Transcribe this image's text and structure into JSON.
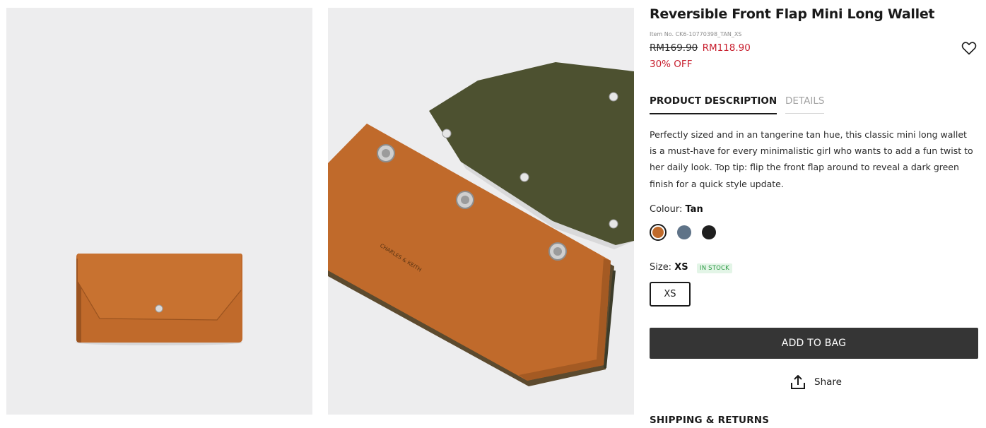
{
  "product": {
    "title": "Reversible Front Flap Mini Long Wallet",
    "item_no": "Item No. CK6-10770398_TAN_XS",
    "price_original": "RM169.90",
    "price_sale": "RM118.90",
    "discount": "30% OFF",
    "wishlist_icon": "heart-outline-icon"
  },
  "tabs": [
    {
      "label": "PRODUCT DESCRIPTION",
      "active": true
    },
    {
      "label": "DETAILS",
      "active": false
    }
  ],
  "description": "Perfectly sized and in an tangerine tan hue, this classic mini long wallet is a must-have for every minimalistic girl who wants to add a fun twist to her daily look. Top tip: flip the front flap around to reveal a dark green finish for a quick style update.",
  "colour": {
    "label": "Colour:",
    "selected": "Tan",
    "swatches": [
      {
        "name": "Tan",
        "hex": "#c06a2b",
        "selected": true
      },
      {
        "name": "Blue",
        "hex": "#5f7388",
        "selected": false
      },
      {
        "name": "Black",
        "hex": "#1f1f1f",
        "selected": false
      }
    ]
  },
  "size": {
    "label": "Size:",
    "selected": "XS",
    "stock": "IN STOCK",
    "options": [
      "XS"
    ]
  },
  "actions": {
    "add_to_bag": "ADD TO BAG",
    "share": "Share",
    "share_icon": "share-upload-icon"
  },
  "sections": {
    "shipping": "SHIPPING & RETURNS"
  },
  "gallery": {
    "image1_brand": "",
    "image2_brand": "CHARLES & KEITH"
  },
  "colors": {
    "sale_red": "#c8202f",
    "button_dark": "#353535",
    "stock_green": "#2e9a45",
    "image_bg": "#ededee",
    "wallet_tan": "#c06a2b",
    "flap_olive": "#4d5130"
  }
}
